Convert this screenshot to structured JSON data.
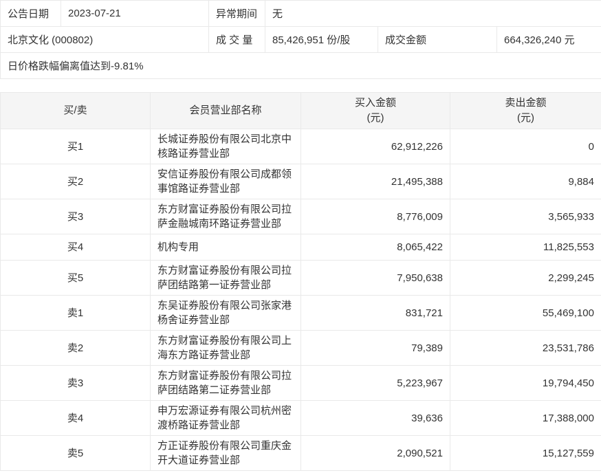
{
  "info": {
    "announce_date_label": "公告日期",
    "announce_date": "2023-07-21",
    "abnormal_period_label": "异常期间",
    "abnormal_period": "无",
    "stock_name": "北京文化 (000802)",
    "volume_label": "成 交 量",
    "volume_value": "85,426,951 份/股",
    "turnover_label": "成交金额",
    "turnover_value": "664,326,240 元",
    "note": "日价格跌幅偏离值达到-9.81%"
  },
  "table": {
    "headers": {
      "side": "买/卖",
      "branch": "会员营业部名称",
      "buy": "买入金额",
      "buy_unit": "(元)",
      "sell": "卖出金额",
      "sell_unit": "(元)"
    },
    "rows": [
      {
        "side": "买1",
        "branch": "长城证券股份有限公司北京中核路证券营业部",
        "buy": "62,912,226",
        "sell": "0"
      },
      {
        "side": "买2",
        "branch": "安信证券股份有限公司成都领事馆路证券营业部",
        "buy": "21,495,388",
        "sell": "9,884"
      },
      {
        "side": "买3",
        "branch": "东方财富证券股份有限公司拉萨金融城南环路证券营业部",
        "buy": "8,776,009",
        "sell": "3,565,933"
      },
      {
        "side": "买4",
        "branch": "机构专用",
        "buy": "8,065,422",
        "sell": "11,825,553"
      },
      {
        "side": "买5",
        "branch": "东方财富证券股份有限公司拉萨团结路第一证券营业部",
        "buy": "7,950,638",
        "sell": "2,299,245"
      },
      {
        "side": "卖1",
        "branch": "东吴证券股份有限公司张家港杨舍证券营业部",
        "buy": "831,721",
        "sell": "55,469,100"
      },
      {
        "side": "卖2",
        "branch": "东方财富证券股份有限公司上海东方路证券营业部",
        "buy": "79,389",
        "sell": "23,531,786"
      },
      {
        "side": "卖3",
        "branch": "东方财富证券股份有限公司拉萨团结路第二证券营业部",
        "buy": "5,223,967",
        "sell": "19,794,450"
      },
      {
        "side": "卖4",
        "branch": "申万宏源证券有限公司杭州密渡桥路证券营业部",
        "buy": "39,636",
        "sell": "17,388,000"
      },
      {
        "side": "卖5",
        "branch": "方正证券股份有限公司重庆金开大道证券营业部",
        "buy": "2,090,521",
        "sell": "15,127,559"
      }
    ]
  },
  "colors": {
    "header_bg": "#f5f5f5",
    "border": "#e9e9e9",
    "text": "#333333"
  }
}
